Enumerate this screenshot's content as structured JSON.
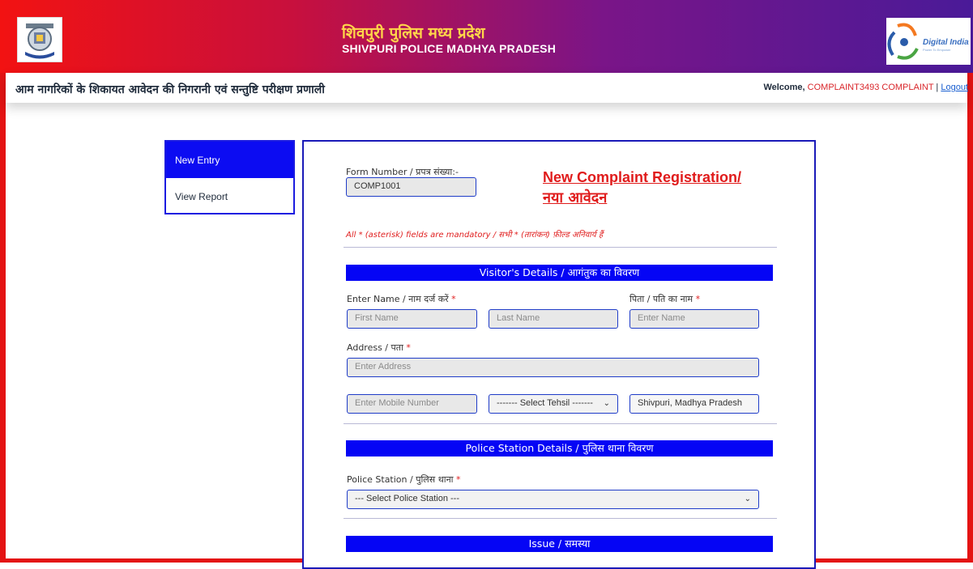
{
  "header": {
    "title_hindi": "शिवपुरी पुलिस मध्य प्रदेश",
    "title_english": "SHIVPURI POLICE MADHYA PRADESH",
    "left_logo": "mp-police-emblem",
    "right_logo": "digital-india-logo",
    "right_logo_text": "Digital India"
  },
  "subheader": {
    "system_title": "आम नागरिकों के शिकायत आवेदन की निगरानी एवं सन्तुष्टि परीक्षण प्रणाली",
    "welcome_label": "Welcome,",
    "username": "COMPLAINT3493 COMPLAINT",
    "separator": "|",
    "logout_label": "Logout"
  },
  "sidebar": {
    "items": [
      {
        "label": "New Entry",
        "active": true
      },
      {
        "label": "View Report",
        "active": false
      }
    ]
  },
  "form": {
    "form_number_label": "Form Number / प्रपत्र संख्या:-",
    "form_number_value": "COMP1001",
    "title_line1": "New Complaint Registration/",
    "title_line2": "नया आवेदन",
    "mandatory_note": "All * (asterisk) fields are mandatory / सभी * (तारांकन) फ़ील्ड अनिवार्य हैं",
    "visitor_section": "Visitor's Details / आगंतुक का विवरण",
    "name_label": "Enter Name / नाम दर्ज करें",
    "father_label": "पिता / पति का नाम",
    "first_name_placeholder": "First Name",
    "last_name_placeholder": "Last Name",
    "father_placeholder": "Enter Name",
    "address_label": "Address / पता",
    "address_placeholder": "Enter Address",
    "mobile_placeholder": "Enter Mobile Number",
    "tehsil_selected": "------- Select Tehsil -------",
    "location_value": "Shivpuri, Madhya Pradesh",
    "police_section": "Police Station Details / पुलिस थाना विवरण",
    "police_label": "Police Station / पुलिस थाना",
    "police_selected": "--- Select Police Station ---",
    "issue_section": "Issue / समस्या",
    "asterisk": "*"
  },
  "colors": {
    "accent_blue": "#0505f5",
    "header_start": "#f21212",
    "header_end": "#4a1a98",
    "required_red": "#e02020"
  },
  "icons": {
    "dropdown": "chevron-down-icon"
  }
}
